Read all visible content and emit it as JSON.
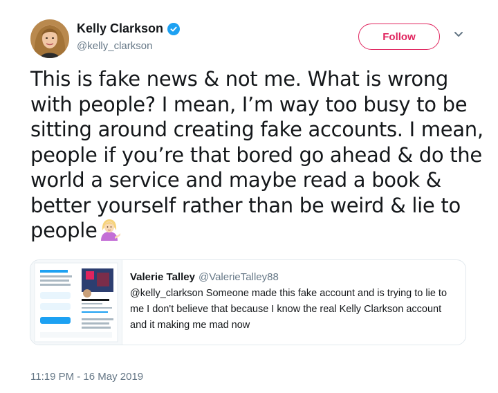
{
  "author": {
    "name": "Kelly Clarkson",
    "handle": "@kelly_clarkson",
    "verified_icon": "verified-badge-icon",
    "avatar_icon": "profile-avatar"
  },
  "actions": {
    "follow_label": "Follow",
    "more_icon": "chevron-down-icon"
  },
  "tweet": {
    "text": "This is fake news & not me. What is wrong with people? I mean, I’m way too busy to be sitting around creating fake accounts. I mean, people if you’re that bored go ahead & do the world a service and maybe read a book & better yourself rather than be weird & lie to people",
    "emoji": "woman-tipping-hand-emoji"
  },
  "quoted_tweet": {
    "name": "Valerie Talley",
    "handle": "@ValerieTalley88",
    "text": "@kelly_clarkson Someone made this fake account and is trying to lie to me I don't believe that because I know the real Kelly Clarkson account and it making me mad now",
    "thumbnail_icon": "screenshot-thumbnail"
  },
  "timestamp": "11:19 PM - 16 May 2019",
  "colors": {
    "follow_accent": "#e0245e",
    "verified": "#1da1f2",
    "secondary_text": "#657786",
    "border": "#e1e8ed"
  }
}
